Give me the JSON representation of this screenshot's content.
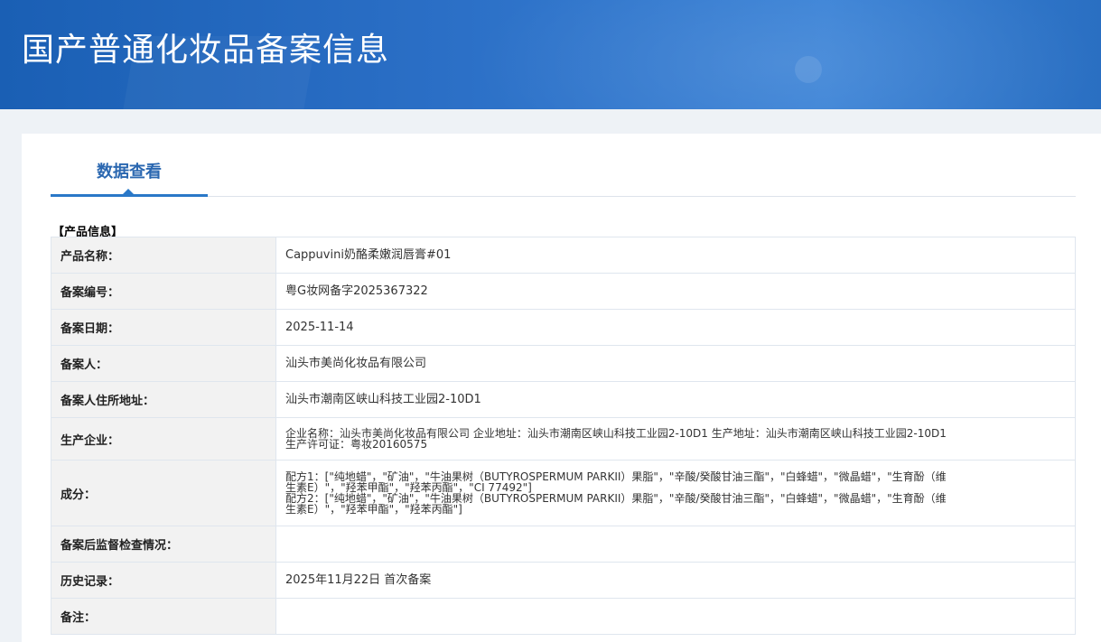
{
  "header": {
    "title": "国产普通化妆品备案信息"
  },
  "tabs": [
    {
      "label": "数据查看"
    }
  ],
  "section": {
    "title": "【产品信息】"
  },
  "rows": [
    {
      "key": "产品名称：",
      "value": "Cappuvini奶酪柔嫩润唇膏#01"
    },
    {
      "key": "备案编号：",
      "value": "粤G妆网备字2025367322"
    },
    {
      "key": "备案日期：",
      "value": "2025-11-14"
    },
    {
      "key": "备案人：",
      "value": "汕头市美尚化妆品有限公司"
    },
    {
      "key": "备案人住所地址：",
      "value": "汕头市潮南区峡山科技工业园2-10D1"
    },
    {
      "key": "生产企业：",
      "value": "企业名称：汕头市美尚化妆品有限公司 企业地址：汕头市潮南区峡山科技工业园2-10D1 生产地址：汕头市潮南区峡山科技工业园2-10D1\n生产许可证：粤妆20160575"
    },
    {
      "key": "成分：",
      "value": "配方1：[\"纯地蜡\"，\"矿油\"，\"牛油果树（BUTYROSPERMUM PARKII）果脂\"，\"辛酸/癸酸甘油三酯\"，\"白蜂蜡\"，\"微晶蜡\"，\"生育酚（维\n生素E）\"，\"羟苯甲酯\"，\"羟苯丙酯\"，\"CI 77492\"]\n配方2：[\"纯地蜡\"，\"矿油\"，\"牛油果树（BUTYROSPERMUM PARKII）果脂\"，\"辛酸/癸酸甘油三酯\"，\"白蜂蜡\"，\"微晶蜡\"，\"生育酚（维\n生素E）\"，\"羟苯甲酯\"，\"羟苯丙酯\"]"
    },
    {
      "key": "备案后监督检查情况：",
      "value": ""
    },
    {
      "key": "历史记录：",
      "value": "2025年11月22日 首次备案"
    },
    {
      "key": "备注：",
      "value": ""
    }
  ]
}
